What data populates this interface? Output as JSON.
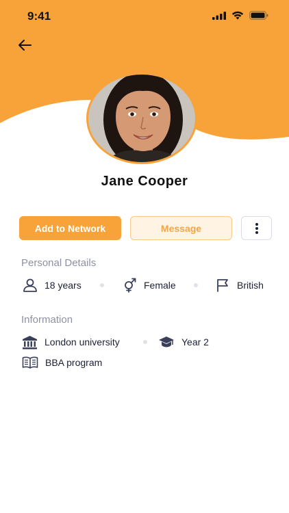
{
  "status_bar": {
    "time": "9:41"
  },
  "profile": {
    "name": "Jane Cooper"
  },
  "actions": {
    "add_label": "Add to Network",
    "message_label": "Message"
  },
  "personal_details": {
    "title": "Personal Details",
    "age": "18 years",
    "gender": "Female",
    "nationality": "British"
  },
  "information": {
    "title": "Information",
    "university": "London university",
    "year": "Year 2",
    "program": "BBA program"
  },
  "colors": {
    "accent": "#f7a33a",
    "accent_light": "#fff3e3",
    "muted_text": "#8c90a3",
    "text": "#1a1f36"
  },
  "icons": [
    "back-arrow-icon",
    "signal-icon",
    "wifi-icon",
    "battery-icon",
    "more-vertical-icon",
    "user-icon",
    "gender-icon",
    "flag-icon",
    "bank-icon",
    "graduation-cap-icon",
    "book-icon"
  ]
}
